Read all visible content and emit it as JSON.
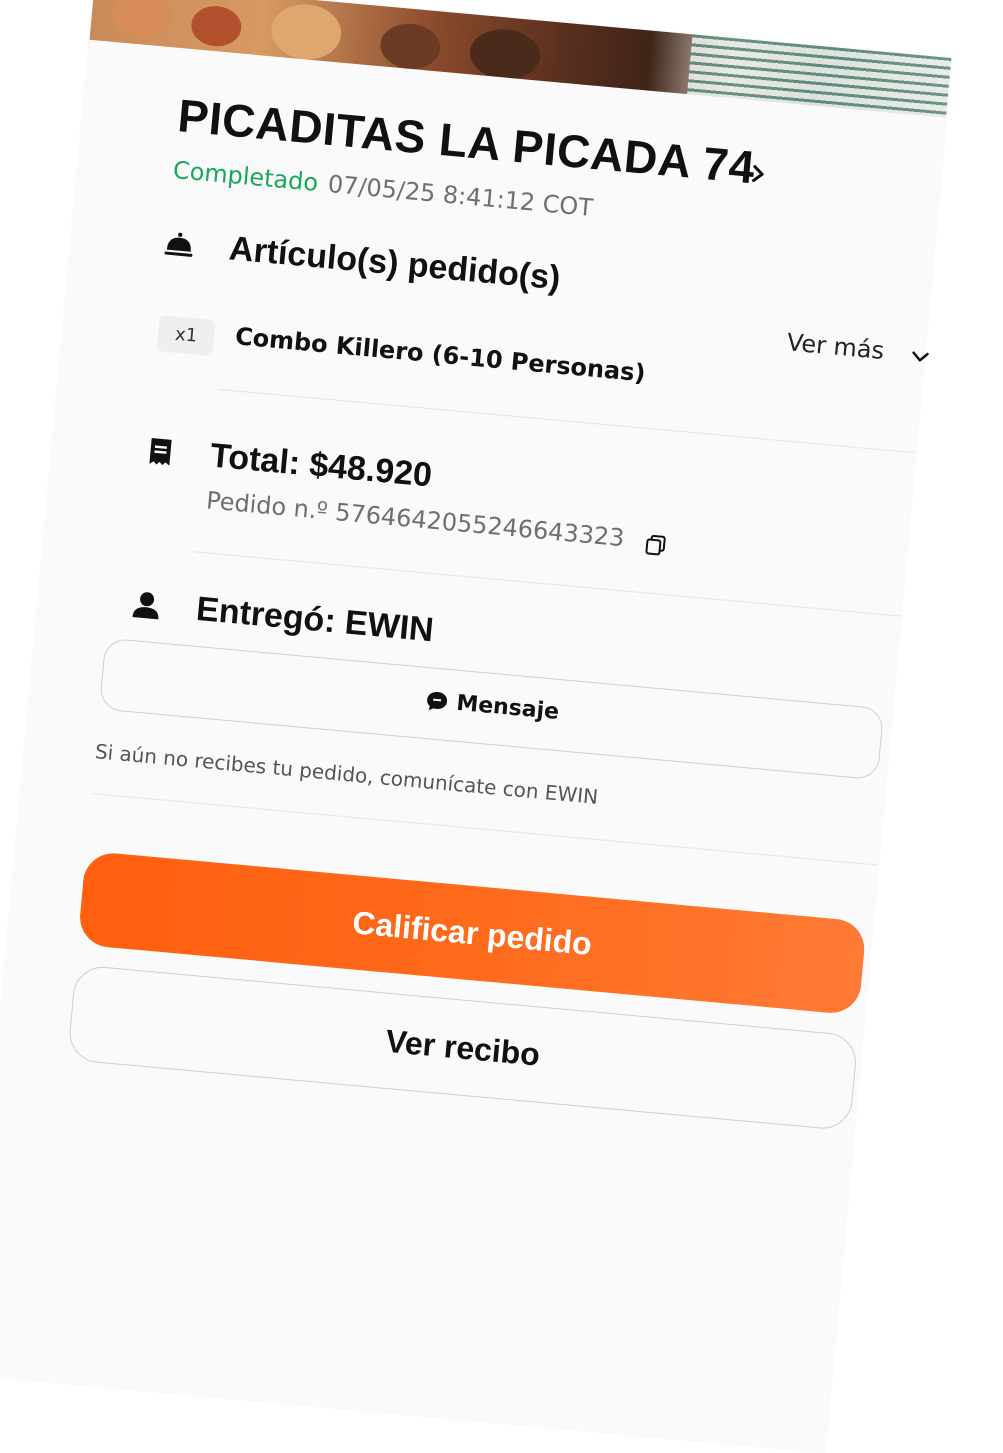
{
  "store": {
    "name": "PICADITAS LA PICADA 74",
    "status": "Completado",
    "datetime": "07/05/25 8:41:12 COT"
  },
  "items_section": {
    "title": "Artículo(s) pedido(s)",
    "icon": "cloche-icon",
    "see_more_label": "Ver más",
    "items": [
      {
        "quantity": "x1",
        "name": "Combo Killero (6-10 Personas)"
      }
    ]
  },
  "total_section": {
    "icon": "receipt-icon",
    "total_label": "Total: $48.920",
    "order_number_label": "Pedido n.º 5764642055246643323"
  },
  "courier_section": {
    "icon": "person-icon",
    "title": "Entregó: EWIN",
    "message_button_label": "Mensaje",
    "hint": "Si aún no recibes tu pedido, comunícate con EWIN"
  },
  "actions": {
    "rate_label": "Calificar pedido",
    "receipt_label": "Ver recibo"
  },
  "colors": {
    "status_green": "#17a85b",
    "accent_orange": "#ff6a1b"
  }
}
